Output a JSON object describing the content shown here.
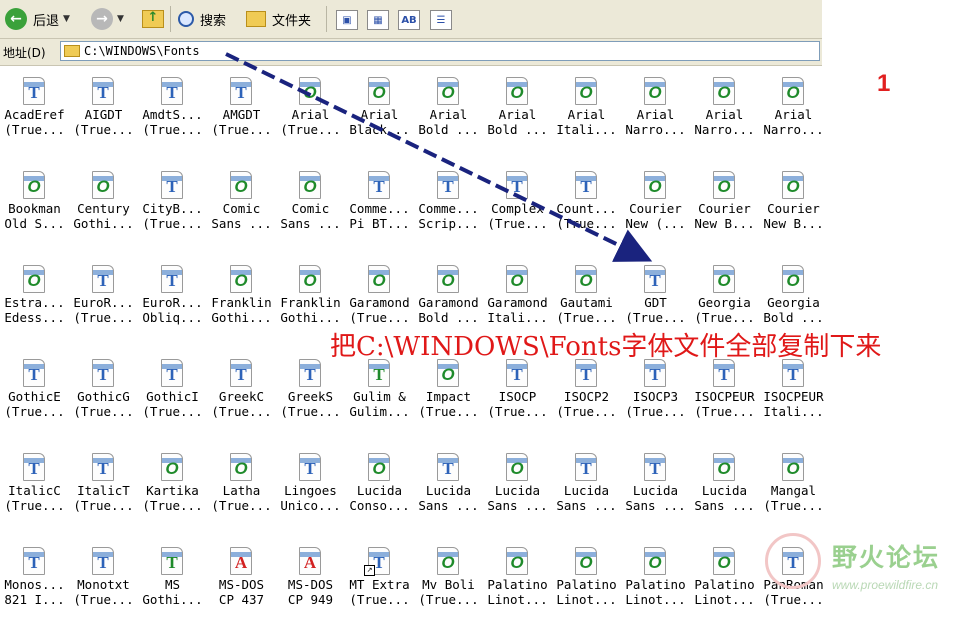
{
  "toolbar": {
    "back_label": "后退",
    "search_label": "搜索",
    "folders_label": "文件夹",
    "view_ab_label": "AB"
  },
  "address": {
    "label": "地址(D)",
    "path": "C:\\WINDOWS\\Fonts"
  },
  "page_marker": "1",
  "annotation": "把C:\\WINDOWS\\Fonts字体文件全部复制下来",
  "watermark": {
    "title": "野火论坛",
    "url": "www.proewildfire.cn"
  },
  "colors": {
    "annotation": "#e01818",
    "arrow": "#1a237e",
    "truetype_icon": "#2d62b8",
    "opentype_icon": "#1e8a2a",
    "raster_icon": "#d22020"
  },
  "font_files": [
    [
      {
        "l1": "AcadEref",
        "l2": "(True...",
        "icon": "truetype"
      },
      {
        "l1": "AIGDT",
        "l2": "(True...",
        "icon": "truetype"
      },
      {
        "l1": "AmdtS...",
        "l2": "(True...",
        "icon": "truetype"
      },
      {
        "l1": "AMGDT",
        "l2": "(True...",
        "icon": "truetype"
      },
      {
        "l1": "Arial",
        "l2": "(True...",
        "icon": "opentype"
      },
      {
        "l1": "Arial",
        "l2": "Black...",
        "icon": "opentype"
      },
      {
        "l1": "Arial",
        "l2": "Bold ...",
        "icon": "opentype"
      },
      {
        "l1": "Arial",
        "l2": "Bold ...",
        "icon": "opentype"
      },
      {
        "l1": "Arial",
        "l2": "Itali...",
        "icon": "opentype"
      },
      {
        "l1": "Arial",
        "l2": "Narro...",
        "icon": "opentype"
      },
      {
        "l1": "Arial",
        "l2": "Narro...",
        "icon": "opentype"
      },
      {
        "l1": "Arial",
        "l2": "Narro...",
        "icon": "opentype"
      }
    ],
    [
      {
        "l1": "Bookman",
        "l2": "Old S...",
        "icon": "opentype"
      },
      {
        "l1": "Century",
        "l2": "Gothi...",
        "icon": "opentype"
      },
      {
        "l1": "CityB...",
        "l2": "(True...",
        "icon": "truetype"
      },
      {
        "l1": "Comic",
        "l2": "Sans ...",
        "icon": "opentype"
      },
      {
        "l1": "Comic",
        "l2": "Sans ...",
        "icon": "opentype"
      },
      {
        "l1": "Comme...",
        "l2": "Pi BT...",
        "icon": "truetype"
      },
      {
        "l1": "Comme...",
        "l2": "Scrip...",
        "icon": "truetype"
      },
      {
        "l1": "Complex",
        "l2": "(True...",
        "icon": "truetype"
      },
      {
        "l1": "Count...",
        "l2": "(True...",
        "icon": "truetype"
      },
      {
        "l1": "Courier",
        "l2": "New (...",
        "icon": "opentype"
      },
      {
        "l1": "Courier",
        "l2": "New B...",
        "icon": "opentype"
      },
      {
        "l1": "Courier",
        "l2": "New B...",
        "icon": "opentype"
      }
    ],
    [
      {
        "l1": "Estra...",
        "l2": "Edess...",
        "icon": "opentype"
      },
      {
        "l1": "EuroR...",
        "l2": "(True...",
        "icon": "truetype"
      },
      {
        "l1": "EuroR...",
        "l2": "Obliq...",
        "icon": "truetype"
      },
      {
        "l1": "Franklin",
        "l2": "Gothi...",
        "icon": "opentype"
      },
      {
        "l1": "Franklin",
        "l2": "Gothi...",
        "icon": "opentype"
      },
      {
        "l1": "Garamond",
        "l2": "(True...",
        "icon": "opentype"
      },
      {
        "l1": "Garamond",
        "l2": "Bold ...",
        "icon": "opentype"
      },
      {
        "l1": "Garamond",
        "l2": "Itali...",
        "icon": "opentype"
      },
      {
        "l1": "Gautami",
        "l2": "(True...",
        "icon": "opentype"
      },
      {
        "l1": "GDT",
        "l2": "(True...",
        "icon": "truetype"
      },
      {
        "l1": "Georgia",
        "l2": "(True...",
        "icon": "opentype"
      },
      {
        "l1": "Georgia",
        "l2": "Bold ...",
        "icon": "opentype"
      }
    ],
    [
      {
        "l1": "GothicE",
        "l2": "(True...",
        "icon": "truetype"
      },
      {
        "l1": "GothicG",
        "l2": "(True...",
        "icon": "truetype"
      },
      {
        "l1": "GothicI",
        "l2": "(True...",
        "icon": "truetype"
      },
      {
        "l1": "GreekC",
        "l2": "(True...",
        "icon": "truetype"
      },
      {
        "l1": "GreekS",
        "l2": "(True...",
        "icon": "truetype"
      },
      {
        "l1": "Gulim &",
        "l2": "Gulim...",
        "icon": "truetype-green"
      },
      {
        "l1": "Impact",
        "l2": "(True...",
        "icon": "opentype"
      },
      {
        "l1": "ISOCP",
        "l2": "(True...",
        "icon": "truetype"
      },
      {
        "l1": "ISOCP2",
        "l2": "(True...",
        "icon": "truetype"
      },
      {
        "l1": "ISOCP3",
        "l2": "(True...",
        "icon": "truetype"
      },
      {
        "l1": "ISOCPEUR",
        "l2": "(True...",
        "icon": "truetype"
      },
      {
        "l1": "ISOCPEUR",
        "l2": "Itali...",
        "icon": "truetype"
      }
    ],
    [
      {
        "l1": "ItalicC",
        "l2": "(True...",
        "icon": "truetype"
      },
      {
        "l1": "ItalicT",
        "l2": "(True...",
        "icon": "truetype"
      },
      {
        "l1": "Kartika",
        "l2": "(True...",
        "icon": "opentype"
      },
      {
        "l1": "Latha",
        "l2": "(True...",
        "icon": "opentype"
      },
      {
        "l1": "Lingoes",
        "l2": "Unico...",
        "icon": "truetype"
      },
      {
        "l1": "Lucida",
        "l2": "Conso...",
        "icon": "opentype"
      },
      {
        "l1": "Lucida",
        "l2": "Sans ...",
        "icon": "truetype"
      },
      {
        "l1": "Lucida",
        "l2": "Sans ...",
        "icon": "opentype"
      },
      {
        "l1": "Lucida",
        "l2": "Sans ...",
        "icon": "truetype"
      },
      {
        "l1": "Lucida",
        "l2": "Sans ...",
        "icon": "truetype"
      },
      {
        "l1": "Lucida",
        "l2": "Sans ...",
        "icon": "opentype"
      },
      {
        "l1": "Mangal",
        "l2": "(True...",
        "icon": "opentype"
      }
    ],
    [
      {
        "l1": "Monos...",
        "l2": "821 I...",
        "icon": "truetype"
      },
      {
        "l1": "Monotxt",
        "l2": "(True...",
        "icon": "truetype"
      },
      {
        "l1": "MS",
        "l2": "Gothi...",
        "icon": "truetype-green"
      },
      {
        "l1": "MS-DOS",
        "l2": "CP 437",
        "icon": "raster"
      },
      {
        "l1": "MS-DOS",
        "l2": "CP 949",
        "icon": "raster"
      },
      {
        "l1": "MT Extra",
        "l2": "(True...",
        "icon": "truetype-shortcut"
      },
      {
        "l1": "Mv Boli",
        "l2": "(True...",
        "icon": "opentype"
      },
      {
        "l1": "Palatino",
        "l2": "Linot...",
        "icon": "opentype"
      },
      {
        "l1": "Palatino",
        "l2": "Linot...",
        "icon": "opentype"
      },
      {
        "l1": "Palatino",
        "l2": "Linot...",
        "icon": "opentype"
      },
      {
        "l1": "Palatino",
        "l2": "Linot...",
        "icon": "opentype"
      },
      {
        "l1": "PanRoman",
        "l2": "(True...",
        "icon": "truetype"
      }
    ]
  ]
}
